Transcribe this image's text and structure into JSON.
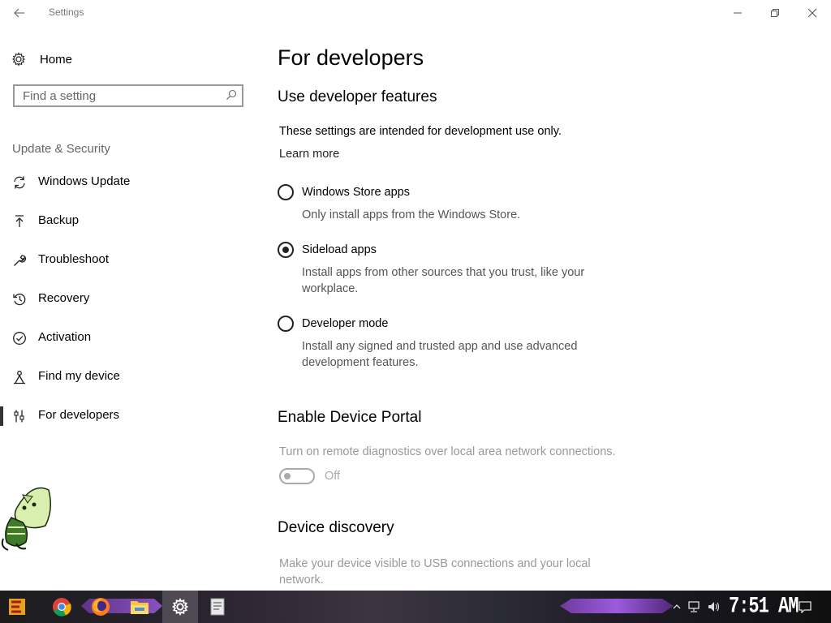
{
  "window": {
    "title": "Settings"
  },
  "sidebar": {
    "home_label": "Home",
    "search_placeholder": "Find a setting",
    "group_title": "Update & Security",
    "items": [
      {
        "label": "Windows Update",
        "icon": "sync-icon"
      },
      {
        "label": "Backup",
        "icon": "backup-arrow-icon"
      },
      {
        "label": "Troubleshoot",
        "icon": "wrench-icon"
      },
      {
        "label": "Recovery",
        "icon": "history-icon"
      },
      {
        "label": "Activation",
        "icon": "check-circle-icon"
      },
      {
        "label": "Find my device",
        "icon": "person-pin-icon"
      },
      {
        "label": "For developers",
        "icon": "developer-tools-icon",
        "selected": true
      }
    ]
  },
  "main": {
    "page_title": "For developers",
    "section1": {
      "title": "Use developer features",
      "description": "These settings are intended for development use only.",
      "learn_more": "Learn more",
      "options": [
        {
          "label": "Windows Store apps",
          "description": "Only install apps from the Windows Store.",
          "checked": false
        },
        {
          "label": "Sideload apps",
          "description": "Install apps from other sources that you trust, like your workplace.",
          "checked": true
        },
        {
          "label": "Developer mode",
          "description": "Install any signed and trusted app and use advanced development features.",
          "checked": false
        }
      ]
    },
    "section2": {
      "title": "Enable Device Portal",
      "description": "Turn on remote diagnostics over local area network connections.",
      "toggle_state": "Off"
    },
    "section3": {
      "title": "Device discovery",
      "description": "Make your device visible to USB connections and your local network."
    }
  },
  "taskbar": {
    "clock": "7:51 AM",
    "apps": [
      "start-icon",
      "chrome-icon",
      "firefox-icon",
      "file-explorer-icon",
      "settings-icon",
      "document-icon"
    ]
  },
  "colors": {
    "accent_selected": "#333333",
    "taskbar_stripe": "#b266ff"
  }
}
